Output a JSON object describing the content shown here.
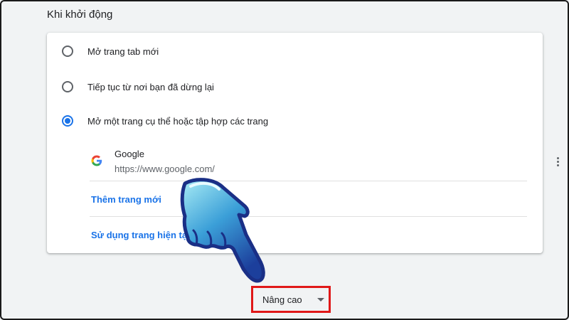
{
  "section": {
    "title": "Khi khởi động"
  },
  "options": [
    {
      "label": "Mở trang tab mới",
      "checked": false
    },
    {
      "label": "Tiếp tục từ nơi bạn đã dừng lại",
      "checked": false
    },
    {
      "label": "Mở một trang cụ thể hoặc tập hợp các trang",
      "checked": true
    }
  ],
  "pages": [
    {
      "name": "Google",
      "url": "https://www.google.com/",
      "icon": "google-favicon"
    }
  ],
  "links": {
    "add_page": "Thêm trang mới",
    "use_current": "Sử dụng trang hiện tại"
  },
  "advanced": {
    "label": "Nâng cao",
    "icon": "caret-down-icon"
  },
  "colors": {
    "accent": "#1a73e8",
    "highlight_box": "#e01818",
    "background": "#f1f3f4"
  }
}
